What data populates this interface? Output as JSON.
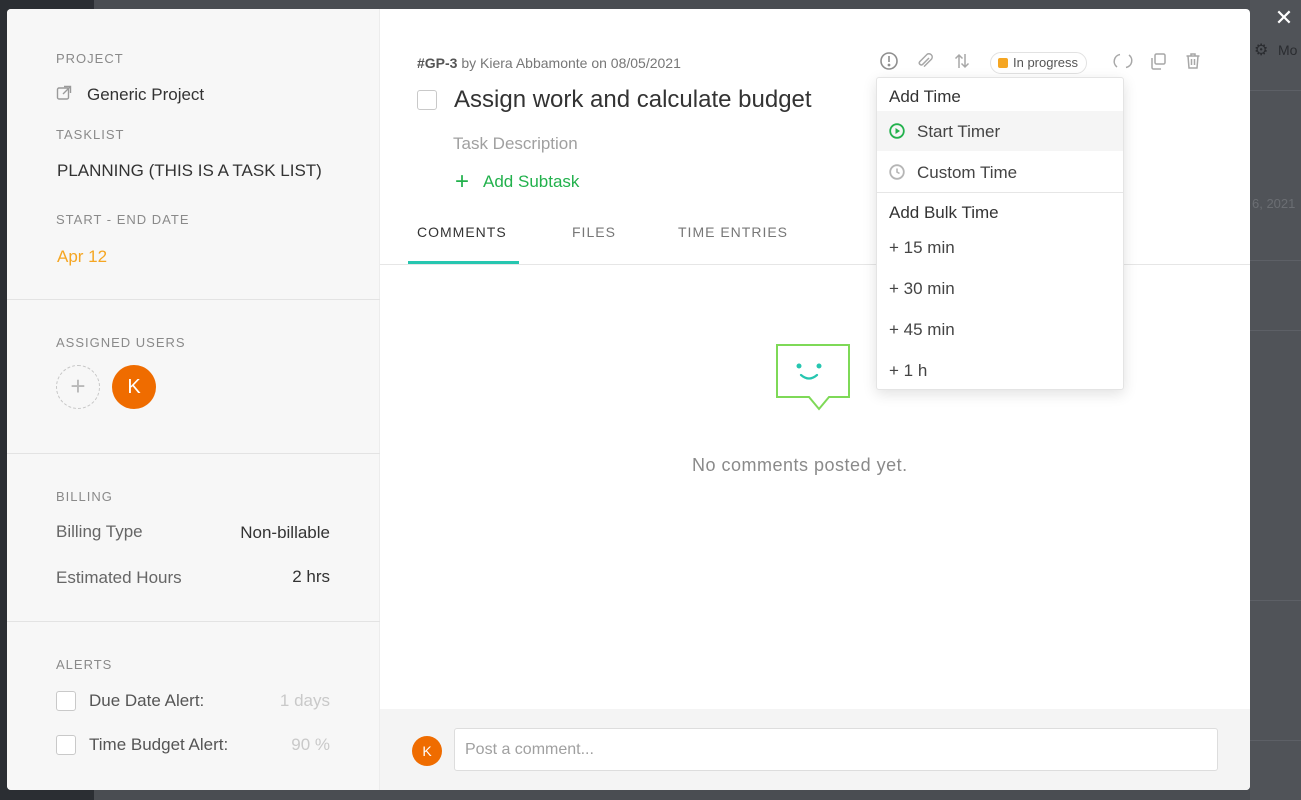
{
  "background": {
    "gear_label": "Mo",
    "date_fragment": "6, 2021"
  },
  "sidebar": {
    "project_label": "PROJECT",
    "project_name": "Generic Project",
    "tasklist_label": "TASKLIST",
    "tasklist_name": "PLANNING (THIS IS A TASK LIST)",
    "date_label": "START - END DATE",
    "date_value": "Apr 12",
    "assigned_label": "ASSIGNED USERS",
    "assigned_users": [
      "K"
    ],
    "billing_label": "BILLING",
    "billing_type_label": "Billing Type",
    "billing_type_value": "Non-billable",
    "estimated_hours_label": "Estimated Hours",
    "estimated_hours_value": "2 hrs",
    "alerts_label": "ALERTS",
    "due_date_alert_label": "Due Date Alert:",
    "due_date_alert_value": "1 days",
    "time_budget_alert_label": "Time Budget Alert:",
    "time_budget_alert_value": "90 %"
  },
  "task": {
    "id": "#GP-3",
    "meta_rest": " by Kiera Abbamonte on 08/05/2021",
    "title": "Assign work and calculate budget",
    "description_placeholder": "Task Description",
    "add_subtask_label": "Add Subtask",
    "status": "In progress",
    "status_color": "#f5a623"
  },
  "tabs": [
    {
      "label": "COMMENTS",
      "active": true
    },
    {
      "label": "FILES",
      "active": false
    },
    {
      "label": "TIME ENTRIES",
      "active": false
    }
  ],
  "comments": {
    "empty_text": "No comments posted yet.",
    "input_placeholder": "Post a comment...",
    "user_initial": "K"
  },
  "time_menu": {
    "add_time_header": "Add Time",
    "start_timer": "Start Timer",
    "custom_time": "Custom Time",
    "bulk_header": "Add Bulk Time",
    "bulk_options": [
      "+ 15 min",
      "+ 30 min",
      "+ 45 min",
      "+ 1 h"
    ]
  },
  "colors": {
    "accent_teal": "#26c6b0",
    "accent_green": "#22b14c",
    "avatar_orange": "#ef6c00",
    "date_orange": "#f5a623"
  }
}
